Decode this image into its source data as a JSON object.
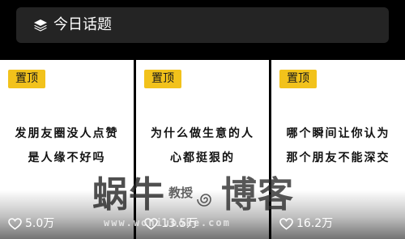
{
  "header": {
    "title": "今日话题",
    "icon": "layers-icon"
  },
  "cards": [
    {
      "badge": "置顶",
      "lines": [
        "发朋友圈没人点赞",
        "是人缘不好吗"
      ],
      "likes": "5.0万"
    },
    {
      "badge": "置顶",
      "lines": [
        "为什么做生意的人",
        "心都挺狠的"
      ],
      "likes": "13.5万"
    },
    {
      "badge": "置顶",
      "lines": [
        "哪个瞬间让你认为",
        "那个朋友不能深交"
      ],
      "likes": "16.2万"
    }
  ],
  "watermark": {
    "left": "蜗牛",
    "small": "教授",
    "right": "博客",
    "url": "www.woniuboke.com"
  },
  "colors": {
    "background": "#000000",
    "header_bg": "#242424",
    "badge_bg": "#f2c21b",
    "card_bg": "#ffffff"
  }
}
